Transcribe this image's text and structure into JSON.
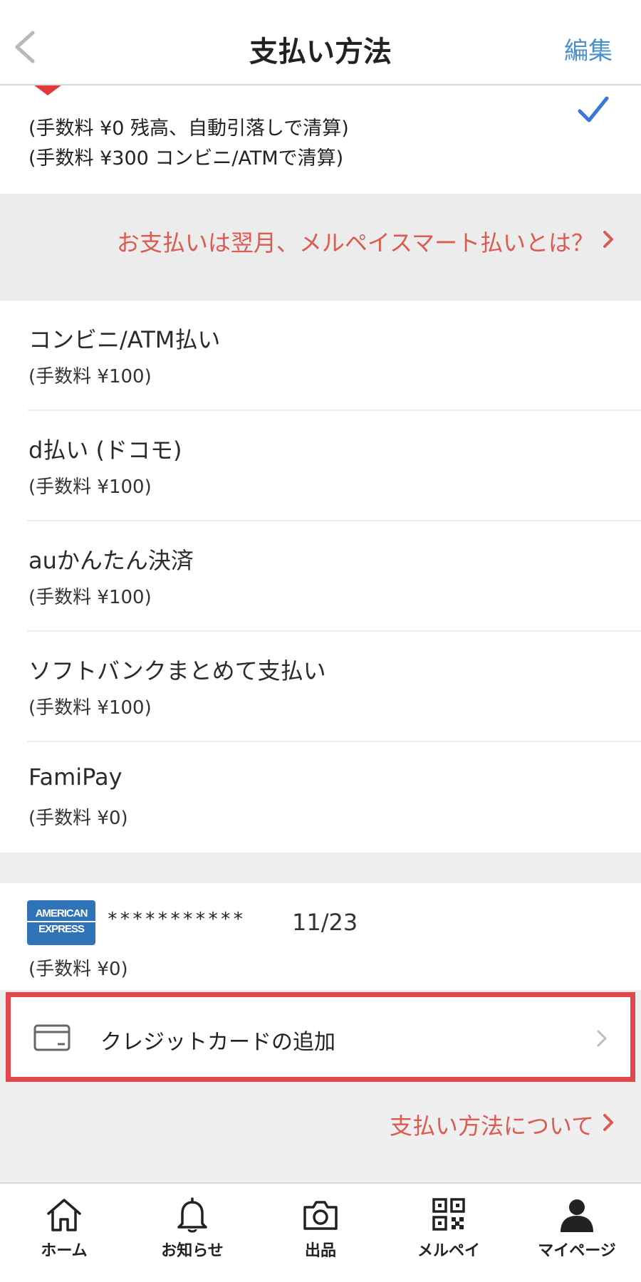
{
  "header": {
    "title": "支払い方法",
    "edit_label": "編集"
  },
  "selected_method": {
    "line1": "(手数料 ¥0 残高、自動引落しで清算)",
    "line2": "(手数料 ¥300 コンビニ/ATMで清算)"
  },
  "banner": {
    "text": "お支払いは翌月、メルペイスマート払いとは？"
  },
  "methods": [
    {
      "name": "コンビニ/ATM払い",
      "fee": "(手数料 ¥100)"
    },
    {
      "name": "d払い (ドコモ)",
      "fee": "(手数料 ¥100)"
    },
    {
      "name": "auかんたん決済",
      "fee": "(手数料 ¥100)"
    },
    {
      "name": "ソフトバンクまとめて支払い",
      "fee": "(手数料 ¥100)"
    },
    {
      "name": "FamiPay",
      "fee": "(手数料 ¥0)"
    }
  ],
  "card": {
    "brand_line1": "AMERICAN",
    "brand_line2": "EXPRESS",
    "masked_number": "***********",
    "expiry": "11/23",
    "fee": "(手数料 ¥0)"
  },
  "add_card": {
    "label": "クレジットカードの追加"
  },
  "about_link": {
    "text": "支払い方法について"
  },
  "tabbar": {
    "items": [
      {
        "label": "ホーム",
        "icon": "home-icon"
      },
      {
        "label": "お知らせ",
        "icon": "bell-icon"
      },
      {
        "label": "出品",
        "icon": "camera-icon"
      },
      {
        "label": "メルペイ",
        "icon": "qr-code-icon"
      },
      {
        "label": "マイページ",
        "icon": "person-icon"
      }
    ]
  },
  "colors": {
    "accent_red": "#dc5a4f",
    "highlight_red": "#e5454d",
    "link_blue": "#4a90c9",
    "check_blue": "#3a78d8",
    "amex_blue": "#2f73b8"
  }
}
